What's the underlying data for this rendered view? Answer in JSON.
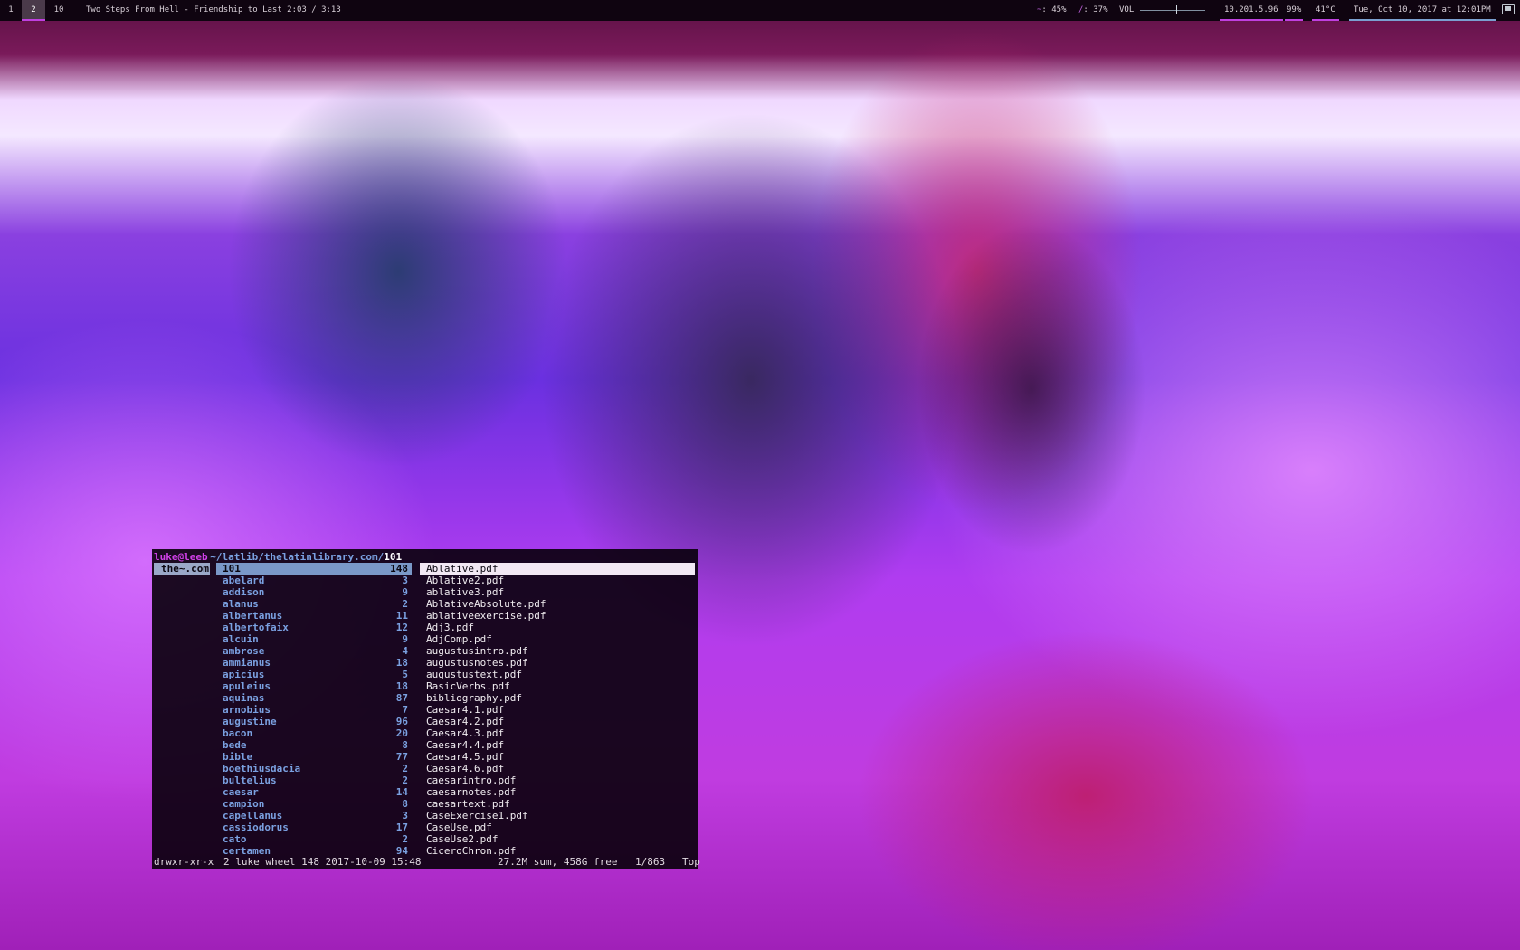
{
  "colors": {
    "accent": "#c040e0",
    "dir": "#7aa0e0",
    "user": "#d040e8",
    "bar_bg": "#0f0410"
  },
  "topbar": {
    "workspaces": [
      {
        "label": "1",
        "active": false
      },
      {
        "label": "2",
        "active": true
      },
      {
        "label": "10",
        "active": false
      }
    ],
    "now_playing": "Two Steps From Hell - Friendship to Last 2:03 / 3:13",
    "home_icon": "~",
    "home_usage": ": 45%",
    "root_icon": "/",
    "root_usage": ": 37%",
    "volume_label": "VOL",
    "volume_level": 0.55,
    "ip": "10.201.5.96",
    "battery": "99%",
    "temperature": "41°C",
    "datetime": "Tue, Oct 10, 2017  at 12:01PM",
    "tray_icon": "screen-icon"
  },
  "ranger": {
    "user_host": "luke@leeb",
    "path_prefix": "~/latlib/thelatinlibrary.com/",
    "current_dir": "101",
    "parent_entries": [
      {
        "name": "the~.com",
        "selected": true
      }
    ],
    "dirs": [
      {
        "name": "101",
        "count": "148",
        "selected": true
      },
      {
        "name": "abelard",
        "count": "3"
      },
      {
        "name": "addison",
        "count": "9"
      },
      {
        "name": "alanus",
        "count": "2"
      },
      {
        "name": "albertanus",
        "count": "11"
      },
      {
        "name": "albertofaix",
        "count": "12"
      },
      {
        "name": "alcuin",
        "count": "9"
      },
      {
        "name": "ambrose",
        "count": "4"
      },
      {
        "name": "ammianus",
        "count": "18"
      },
      {
        "name": "apicius",
        "count": "5"
      },
      {
        "name": "apuleius",
        "count": "18"
      },
      {
        "name": "aquinas",
        "count": "87"
      },
      {
        "name": "arnobius",
        "count": "7"
      },
      {
        "name": "augustine",
        "count": "96"
      },
      {
        "name": "bacon",
        "count": "20"
      },
      {
        "name": "bede",
        "count": "8"
      },
      {
        "name": "bible",
        "count": "77"
      },
      {
        "name": "boethiusdacia",
        "count": "2"
      },
      {
        "name": "bultelius",
        "count": "2"
      },
      {
        "name": "caesar",
        "count": "14"
      },
      {
        "name": "campion",
        "count": "8"
      },
      {
        "name": "capellanus",
        "count": "3"
      },
      {
        "name": "cassiodorus",
        "count": "17"
      },
      {
        "name": "cato",
        "count": "2"
      },
      {
        "name": "certamen",
        "count": "94"
      }
    ],
    "files": [
      {
        "name": "Ablative.pdf",
        "selected": true
      },
      {
        "name": "Ablative2.pdf"
      },
      {
        "name": "ablative3.pdf"
      },
      {
        "name": "AblativeAbsolute.pdf"
      },
      {
        "name": "ablativeexercise.pdf"
      },
      {
        "name": "Adj3.pdf"
      },
      {
        "name": "AdjComp.pdf"
      },
      {
        "name": "augustusintro.pdf"
      },
      {
        "name": "augustusnotes.pdf"
      },
      {
        "name": "augustustext.pdf"
      },
      {
        "name": "BasicVerbs.pdf"
      },
      {
        "name": "bibliography.pdf"
      },
      {
        "name": "Caesar4.1.pdf"
      },
      {
        "name": "Caesar4.2.pdf"
      },
      {
        "name": "Caesar4.3.pdf"
      },
      {
        "name": "Caesar4.4.pdf"
      },
      {
        "name": "Caesar4.5.pdf"
      },
      {
        "name": "Caesar4.6.pdf"
      },
      {
        "name": "caesarintro.pdf"
      },
      {
        "name": "caesarnotes.pdf"
      },
      {
        "name": "caesartext.pdf"
      },
      {
        "name": "CaseExercise1.pdf"
      },
      {
        "name": "CaseUse.pdf"
      },
      {
        "name": "CaseUse2.pdf"
      },
      {
        "name": "CiceroChron.pdf"
      }
    ],
    "status": {
      "permissions": "drwxr-xr-x",
      "meta": "2 luke wheel 148 2017-10-09 15:48",
      "disk": "27.2M sum, 458G free",
      "position": "1/863",
      "scroll": "Top"
    }
  }
}
